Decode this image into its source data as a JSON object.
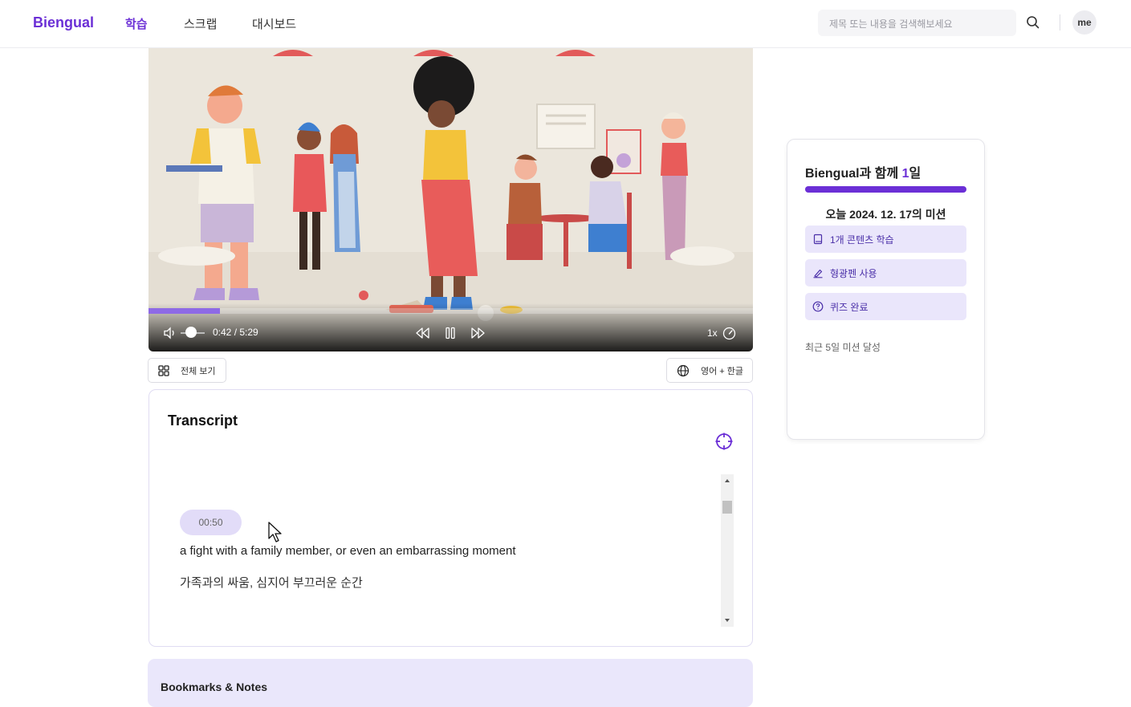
{
  "nav": {
    "logo": "Biengual",
    "links": [
      "학습",
      "스크랩",
      "대시보드"
    ],
    "active_index": 0,
    "search_placeholder": "제목 또는 내용을 검색해보세요",
    "avatar": "me"
  },
  "player": {
    "time": "0:42 / 5:29",
    "progress": 0.118,
    "volume": 0.55,
    "speed": "1x",
    "state": "playing"
  },
  "controls": {
    "view_all": "전체 보기",
    "language": "영어 + 한글"
  },
  "transcript": {
    "title": "Transcript",
    "timestamp": "00:50",
    "english": "a fight with a family member, or even an embarrassing moment",
    "korean": "가족과의 싸움, 심지어 부끄러운 순간"
  },
  "bookmarks": {
    "title": "Bookmarks & Notes"
  },
  "mission": {
    "title_prefix": "Biengual과 함께 ",
    "days": "1",
    "title_suffix": "일",
    "streak_progress": 1.0,
    "date_line": "오늘 2024. 12. 17의 미션",
    "tasks": [
      {
        "label": "1개 콘텐츠 학습",
        "icon": "book-icon"
      },
      {
        "label": "형광펜 사용",
        "icon": "highlighter-icon"
      },
      {
        "label": "퀴즈 완료",
        "icon": "question-circle-icon"
      }
    ],
    "recent": "최근 5일 미션 달성"
  },
  "colors": {
    "accent": "#6b2fd6",
    "accent_light": "#eae6fb",
    "progress": "#8e6ae6"
  }
}
